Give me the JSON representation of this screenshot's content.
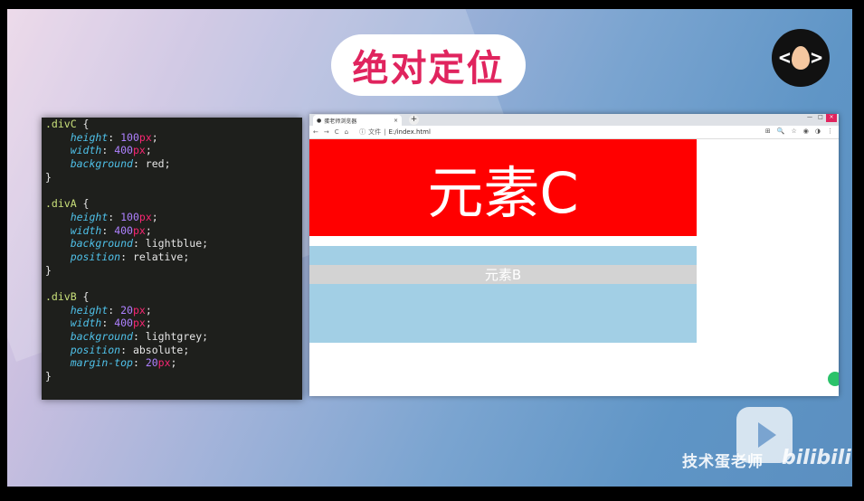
{
  "slide": {
    "title": "绝对定位",
    "watermark": "技术蛋老师",
    "platform": "bilibili"
  },
  "logo": {
    "left": "<",
    "right": ">"
  },
  "code": {
    "lines": [
      [
        {
          "t": ".divC ",
          "c": "sel"
        },
        {
          "t": "{",
          "c": "val"
        }
      ],
      [
        {
          "t": "    ",
          "c": "val"
        },
        {
          "t": "height",
          "c": "prop"
        },
        {
          "t": ": ",
          "c": "val"
        },
        {
          "t": "100",
          "c": "num"
        },
        {
          "t": "px",
          "c": "unit"
        },
        {
          "t": ";",
          "c": "val"
        }
      ],
      [
        {
          "t": "    ",
          "c": "val"
        },
        {
          "t": "width",
          "c": "prop"
        },
        {
          "t": ": ",
          "c": "val"
        },
        {
          "t": "400",
          "c": "num"
        },
        {
          "t": "px",
          "c": "unit"
        },
        {
          "t": ";",
          "c": "val"
        }
      ],
      [
        {
          "t": "    ",
          "c": "val"
        },
        {
          "t": "background",
          "c": "prop"
        },
        {
          "t": ": red;",
          "c": "val"
        }
      ],
      [
        {
          "t": "}",
          "c": "val"
        }
      ],
      [
        {
          "t": "",
          "c": "val"
        }
      ],
      [
        {
          "t": ".divA ",
          "c": "sel"
        },
        {
          "t": "{",
          "c": "val"
        }
      ],
      [
        {
          "t": "    ",
          "c": "val"
        },
        {
          "t": "height",
          "c": "prop"
        },
        {
          "t": ": ",
          "c": "val"
        },
        {
          "t": "100",
          "c": "num"
        },
        {
          "t": "px",
          "c": "unit"
        },
        {
          "t": ";",
          "c": "val"
        }
      ],
      [
        {
          "t": "    ",
          "c": "val"
        },
        {
          "t": "width",
          "c": "prop"
        },
        {
          "t": ": ",
          "c": "val"
        },
        {
          "t": "400",
          "c": "num"
        },
        {
          "t": "px",
          "c": "unit"
        },
        {
          "t": ";",
          "c": "val"
        }
      ],
      [
        {
          "t": "    ",
          "c": "val"
        },
        {
          "t": "background",
          "c": "prop"
        },
        {
          "t": ": lightblue;",
          "c": "val"
        }
      ],
      [
        {
          "t": "    ",
          "c": "val"
        },
        {
          "t": "position",
          "c": "prop"
        },
        {
          "t": ": relative;",
          "c": "val"
        }
      ],
      [
        {
          "t": "}",
          "c": "val"
        }
      ],
      [
        {
          "t": "",
          "c": "val"
        }
      ],
      [
        {
          "t": ".divB ",
          "c": "sel"
        },
        {
          "t": "{",
          "c": "val"
        }
      ],
      [
        {
          "t": "    ",
          "c": "val"
        },
        {
          "t": "height",
          "c": "prop"
        },
        {
          "t": ": ",
          "c": "val"
        },
        {
          "t": "20",
          "c": "num"
        },
        {
          "t": "px",
          "c": "unit"
        },
        {
          "t": ";",
          "c": "val"
        }
      ],
      [
        {
          "t": "    ",
          "c": "val"
        },
        {
          "t": "width",
          "c": "prop"
        },
        {
          "t": ": ",
          "c": "val"
        },
        {
          "t": "400",
          "c": "num"
        },
        {
          "t": "px",
          "c": "unit"
        },
        {
          "t": ";",
          "c": "val"
        }
      ],
      [
        {
          "t": "    ",
          "c": "val"
        },
        {
          "t": "background",
          "c": "prop"
        },
        {
          "t": ": lightgrey;",
          "c": "val"
        }
      ],
      [
        {
          "t": "    ",
          "c": "val"
        },
        {
          "t": "position",
          "c": "prop"
        },
        {
          "t": ": absolute;",
          "c": "val"
        }
      ],
      [
        {
          "t": "    ",
          "c": "val"
        },
        {
          "t": "margin-top",
          "c": "prop"
        },
        {
          "t": ": ",
          "c": "val"
        },
        {
          "t": "20",
          "c": "num"
        },
        {
          "t": "px",
          "c": "unit"
        },
        {
          "t": ";",
          "c": "val"
        }
      ],
      [
        {
          "t": "}",
          "c": "val"
        }
      ]
    ]
  },
  "browser": {
    "tab_title": "蛋老师浏览器",
    "tab_close": "×",
    "new_tab": "+",
    "window_controls": [
      "—",
      "□",
      "×"
    ],
    "nav": [
      "←",
      "→",
      "C",
      "⌂"
    ],
    "security_label": "文件",
    "url": "E:/index.html",
    "toolbar_icons": [
      "⊞",
      "🔍",
      "☆",
      "◉",
      "◑",
      "⋮"
    ]
  },
  "page": {
    "divC_text": "元素C",
    "divB_text": "元素B"
  },
  "colors": {
    "title": "#e0245e",
    "divC": "#ff0000",
    "divA": "#a2cfe5",
    "divB": "#d3d3d3"
  }
}
